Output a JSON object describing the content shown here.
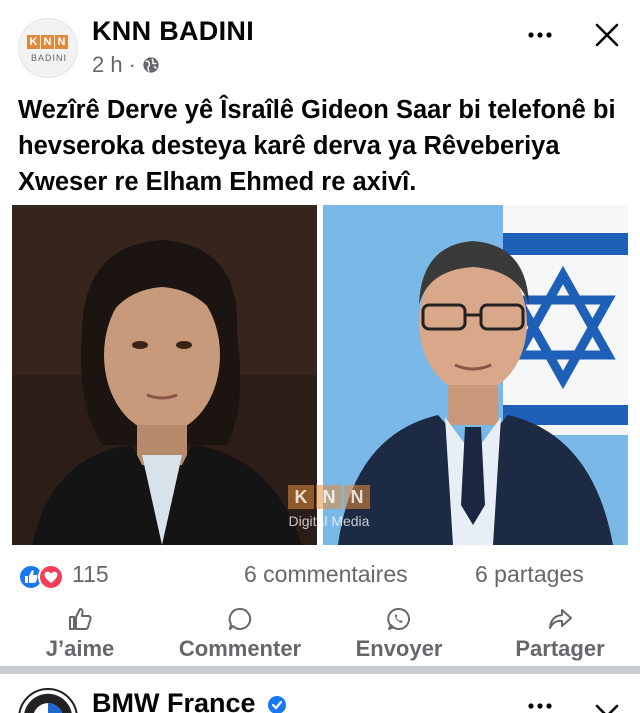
{
  "post": {
    "page_name": "KNN BADINI",
    "avatar_logo_letters": [
      "K",
      "N",
      "N"
    ],
    "avatar_logo_sub": "BADINI",
    "time": "2 h",
    "meta_separator": "·",
    "privacy_icon": "globe-icon",
    "text": "Wezîrê Derve yê Îsraîlê Gideon Saar bi telefonê bi hevseroka desteya karê derva ya Rêveberiya Xweser re Elham Ehmed re axivî.",
    "watermark_letters": [
      "K",
      "N",
      "N"
    ],
    "watermark_text": "Digital Media"
  },
  "stats": {
    "reaction_icons": [
      "like-reaction-icon",
      "love-reaction-icon"
    ],
    "reaction_count": "115",
    "comments": "6 commentaires",
    "shares": "6 partages"
  },
  "actions": {
    "like": "J’aime",
    "comment": "Commenter",
    "send": "Envoyer",
    "share": "Partager"
  },
  "next_post": {
    "page_name": "BMW France"
  },
  "colors": {
    "accent_blue": "#1877f2",
    "love_red": "#f33e58",
    "text_secondary": "#65676b",
    "divider": "#c9ccd1",
    "knn_orange": "#e08a3c"
  }
}
